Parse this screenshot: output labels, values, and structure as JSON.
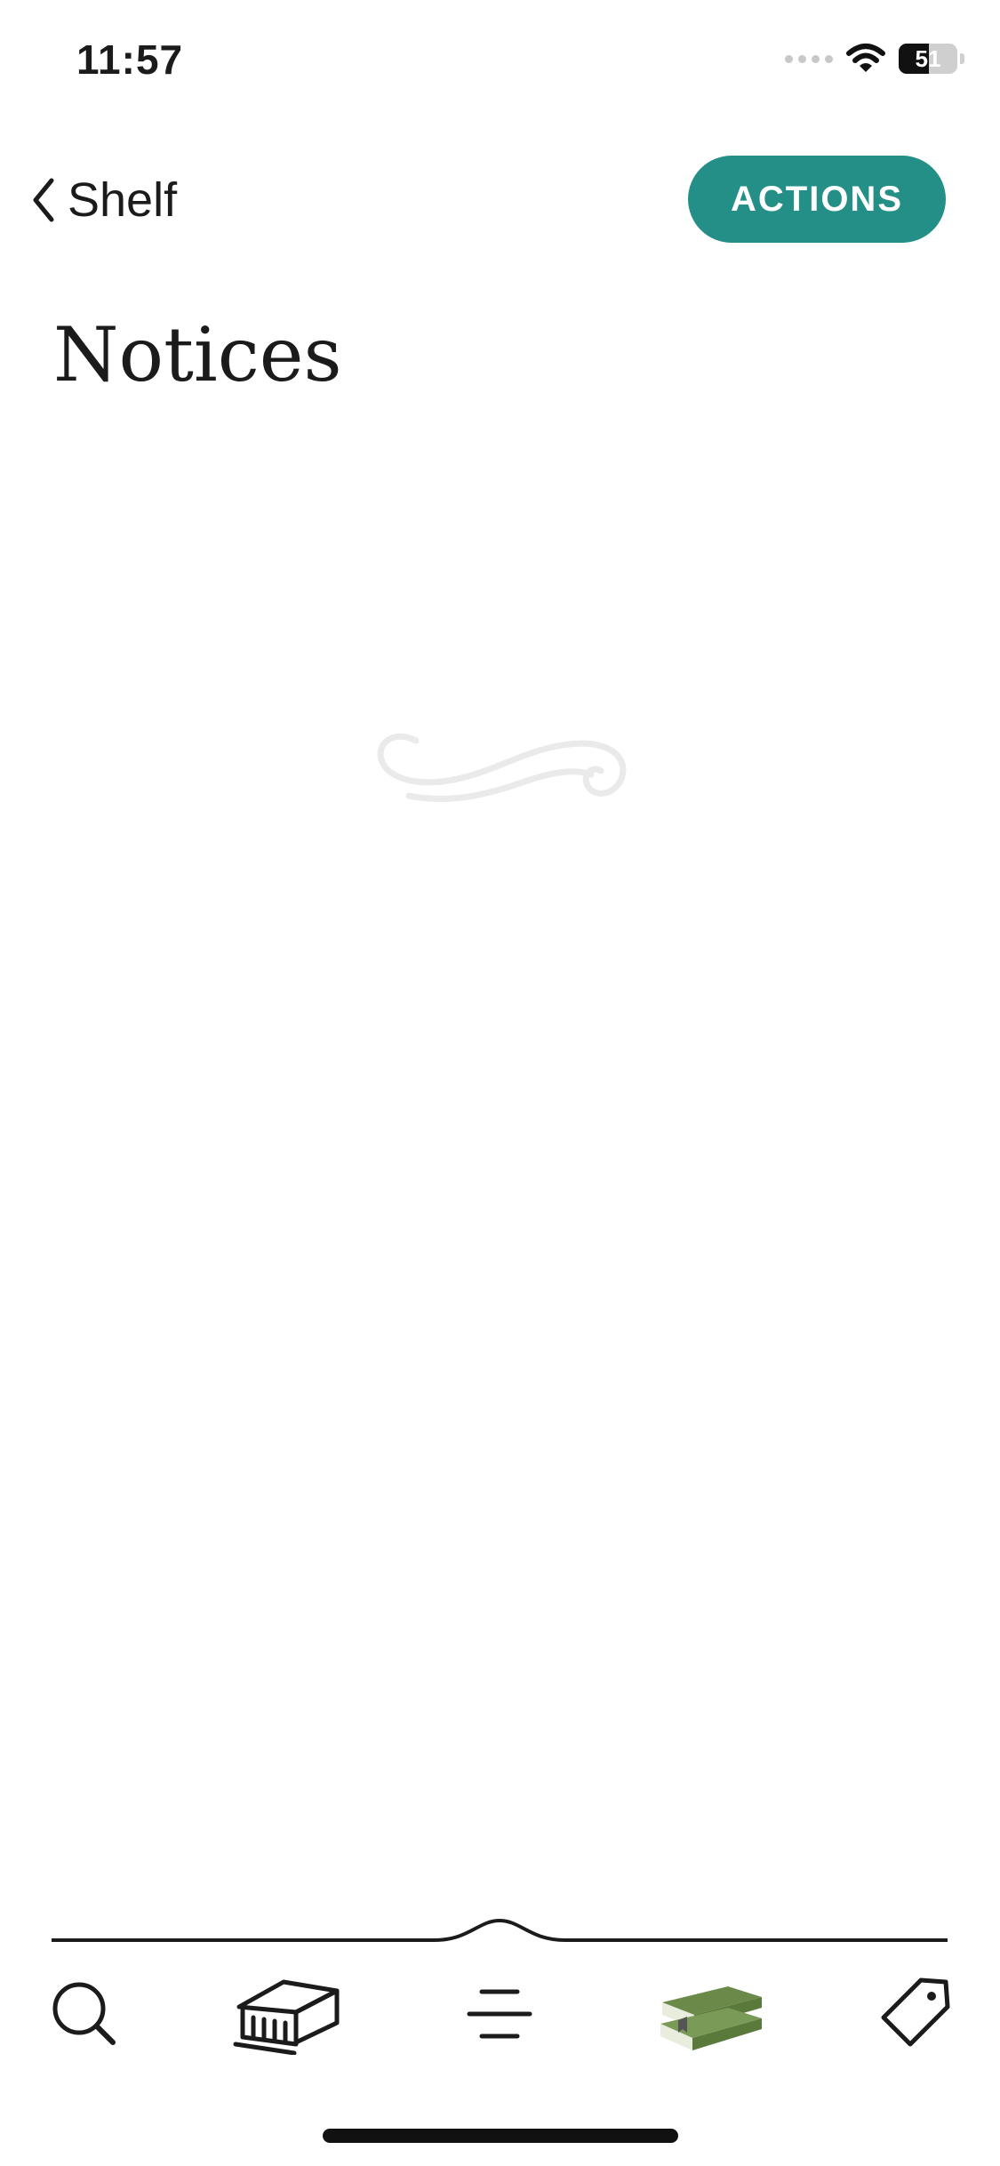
{
  "status_bar": {
    "time": "11:57",
    "battery_percent": 51,
    "battery_label": "51",
    "icons": [
      "cellular-signal-icon",
      "wifi-icon",
      "battery-icon"
    ]
  },
  "nav": {
    "back_label": "Shelf",
    "actions_label": "ACTIONS"
  },
  "page": {
    "title": "Notices"
  },
  "tabs": [
    {
      "icon": "search-icon",
      "active": false
    },
    {
      "icon": "library-building-icon",
      "active": false
    },
    {
      "icon": "menu-icon",
      "active": false
    },
    {
      "icon": "bookshelf-books-icon",
      "active": true
    },
    {
      "icon": "tag-icon",
      "active": false
    }
  ],
  "colors": {
    "accent": "#238f86",
    "active_tab": "#6b8a4a",
    "text": "#1b1b1b",
    "flourish": "#eaeaea"
  }
}
